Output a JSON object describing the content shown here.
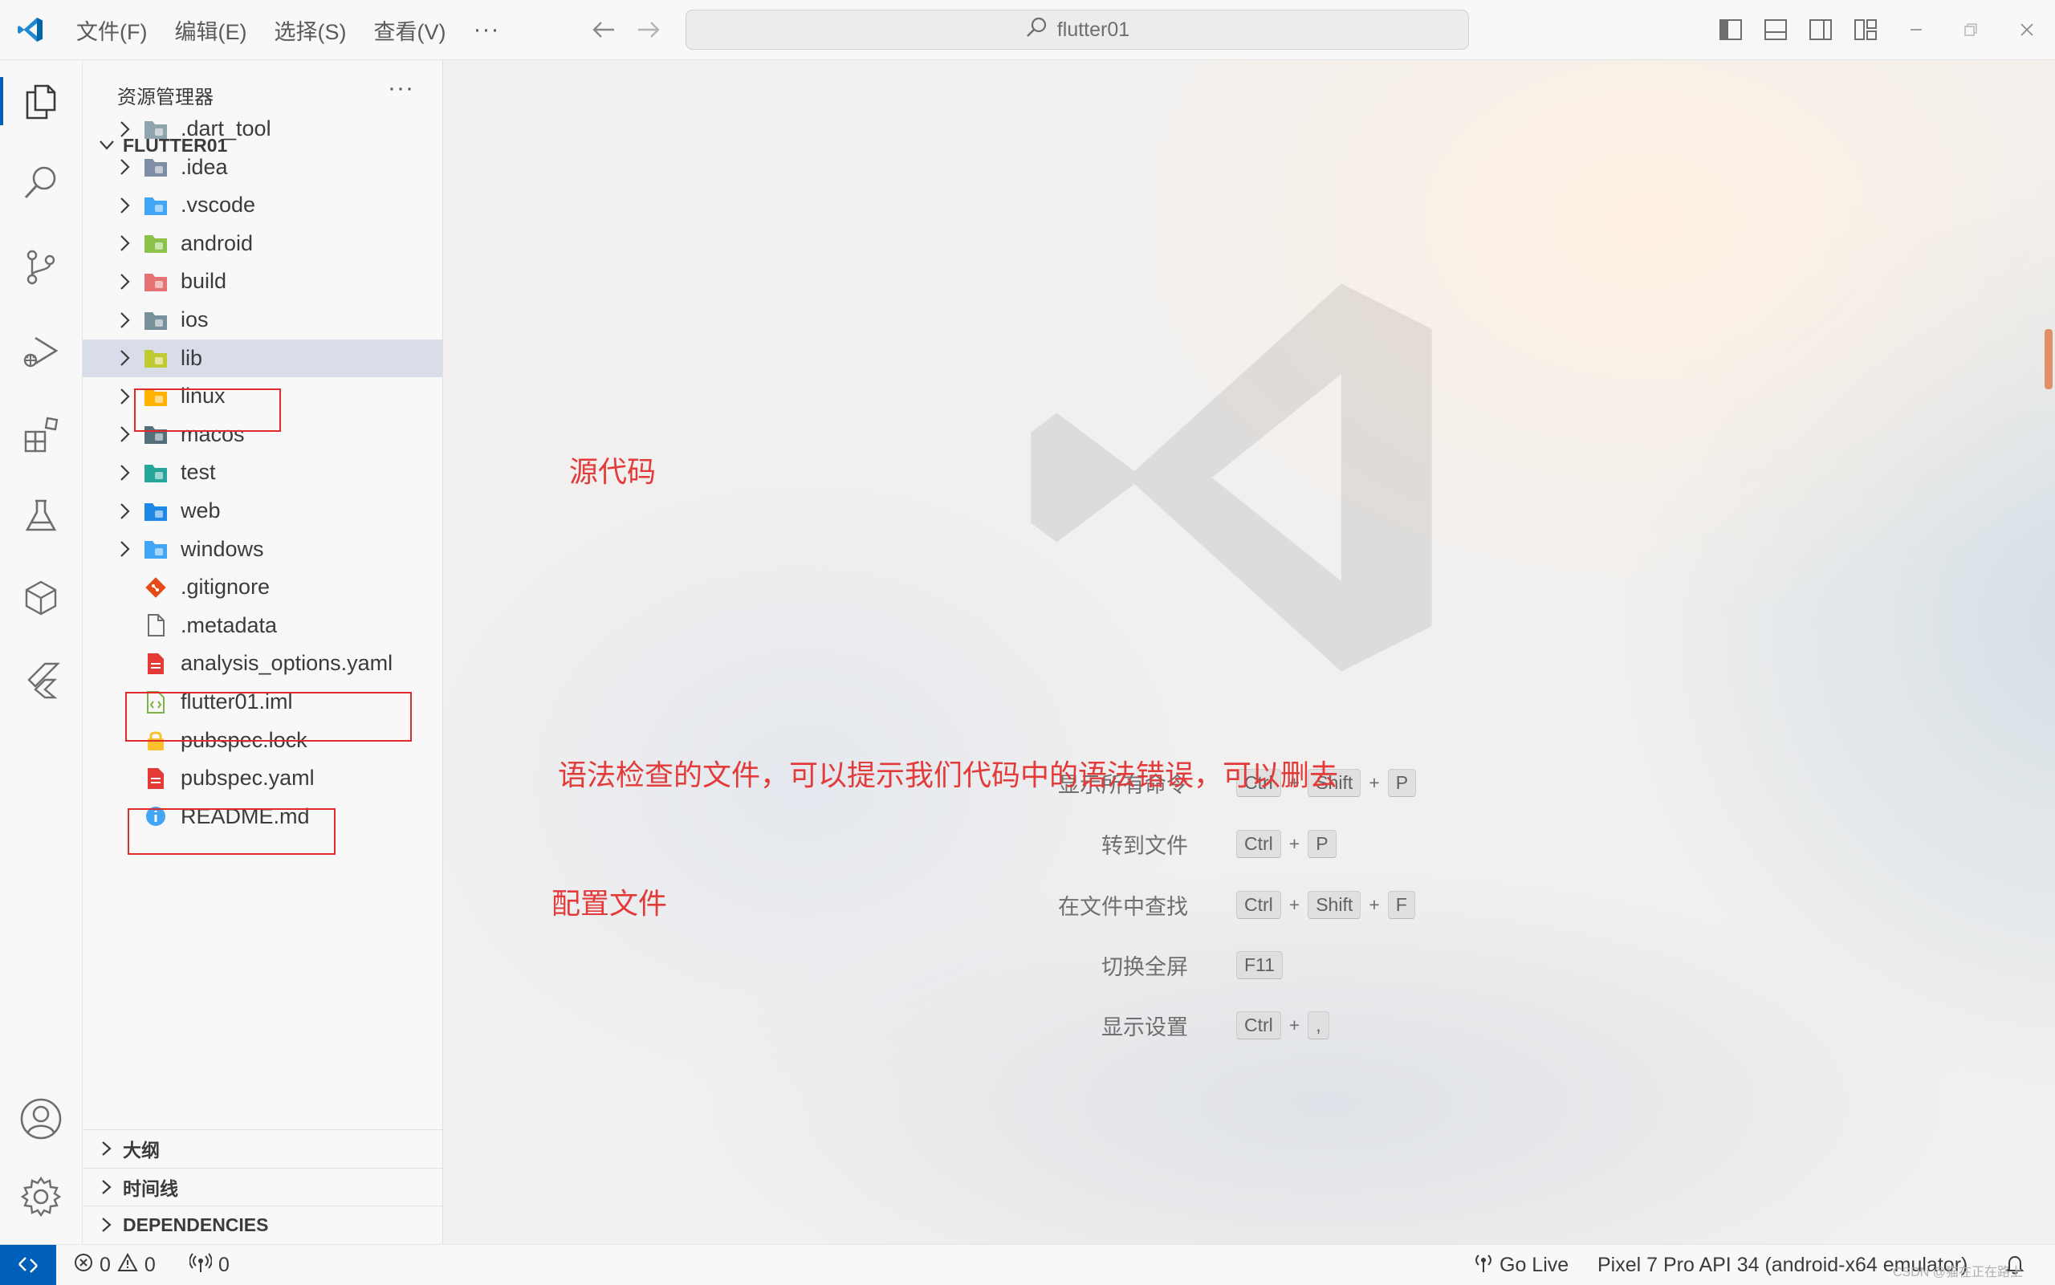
{
  "window": {
    "search_text": "flutter01"
  },
  "menu": {
    "items": [
      "文件(F)",
      "编辑(E)",
      "选择(S)",
      "查看(V)"
    ],
    "more": "···"
  },
  "sidebar": {
    "title": "资源管理器",
    "more": "···",
    "folder": "FLUTTER01",
    "tree": [
      {
        "name": ".dart_tool",
        "type": "folder",
        "icon": "folder-gray-icon"
      },
      {
        "name": ".idea",
        "type": "folder",
        "icon": "folder-idea-icon"
      },
      {
        "name": ".vscode",
        "type": "folder",
        "icon": "folder-vscode-icon"
      },
      {
        "name": "android",
        "type": "folder",
        "icon": "folder-android-icon"
      },
      {
        "name": "build",
        "type": "folder",
        "icon": "folder-build-icon"
      },
      {
        "name": "ios",
        "type": "folder",
        "icon": "folder-ios-icon"
      },
      {
        "name": "lib",
        "type": "folder",
        "icon": "folder-lib-icon"
      },
      {
        "name": "linux",
        "type": "folder",
        "icon": "folder-linux-icon"
      },
      {
        "name": "macos",
        "type": "folder",
        "icon": "folder-macos-icon"
      },
      {
        "name": "test",
        "type": "folder",
        "icon": "folder-test-icon"
      },
      {
        "name": "web",
        "type": "folder",
        "icon": "folder-web-icon"
      },
      {
        "name": "windows",
        "type": "folder",
        "icon": "folder-windows-icon"
      },
      {
        "name": ".gitignore",
        "type": "file",
        "icon": "git-icon"
      },
      {
        "name": ".metadata",
        "type": "file",
        "icon": "file-icon"
      },
      {
        "name": "analysis_options.yaml",
        "type": "file",
        "icon": "yaml-icon"
      },
      {
        "name": "flutter01.iml",
        "type": "file",
        "icon": "iml-icon"
      },
      {
        "name": "pubspec.lock",
        "type": "file",
        "icon": "lock-icon"
      },
      {
        "name": "pubspec.yaml",
        "type": "file",
        "icon": "yaml-icon"
      },
      {
        "name": "README.md",
        "type": "file",
        "icon": "info-icon"
      }
    ],
    "panels": [
      "大纲",
      "时间线",
      "DEPENDENCIES"
    ]
  },
  "editor": {
    "shortcuts": [
      {
        "label": "显示所有命令",
        "keys": [
          "Ctrl",
          "Shift",
          "P"
        ]
      },
      {
        "label": "转到文件",
        "keys": [
          "Ctrl",
          "P"
        ]
      },
      {
        "label": "在文件中查找",
        "keys": [
          "Ctrl",
          "Shift",
          "F"
        ]
      },
      {
        "label": "切换全屏",
        "keys": [
          "F11"
        ]
      },
      {
        "label": "显示设置",
        "keys": [
          "Ctrl",
          ","
        ]
      }
    ],
    "annotations": {
      "lib": "源代码",
      "analysis": "语法检查的文件，可以提示我们代码中的语法错误，可以删去",
      "pubspec": "配置文件"
    }
  },
  "statusbar": {
    "errors": "0",
    "warnings": "0",
    "ports": "0",
    "go_live": "Go Live",
    "device": "Pixel 7 Pro API 34 (android-x64 emulator)",
    "watermark": "CSDN @猫在正在路上"
  },
  "colors": {
    "accent": "#005fb8",
    "annotation": "#e33a3a",
    "selection": "#d8dde9"
  }
}
